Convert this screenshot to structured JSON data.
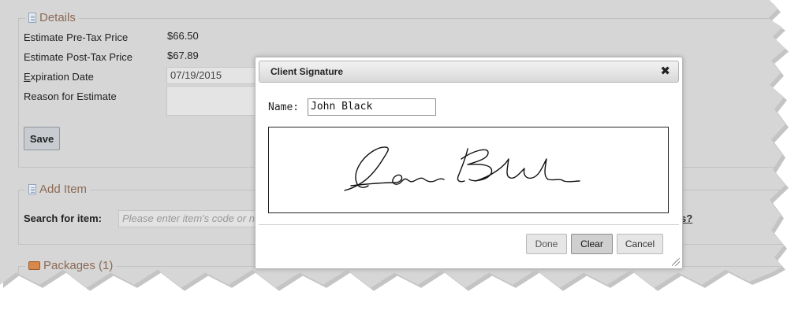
{
  "details": {
    "legend": "Details",
    "pretax_label": "Estimate Pre-Tax Price",
    "pretax_value": "$66.50",
    "posttax_label": "Estimate Post-Tax Price",
    "posttax_value": "$67.89",
    "expiration_label_first": "E",
    "expiration_label_rest": "xpiration Date",
    "expiration_value": "07/19/2015",
    "reason_label": "Reason for Estimate",
    "save_label": "Save"
  },
  "add_item": {
    "legend": "Add Item",
    "search_label": "Search for item:",
    "search_placeholder": "Please enter item's code or n",
    "help_fragment": "s?"
  },
  "packages": {
    "legend": "Packages (1)"
  },
  "dialog": {
    "title": "Client Signature",
    "close_glyph": "✖",
    "name_label": "Name:",
    "name_value": "John Black",
    "done_label": "Done",
    "clear_label": "Clear",
    "cancel_label": "Cancel"
  },
  "icons": {
    "details": "document-icon",
    "add_item": "document-icon",
    "packages": "package-icon",
    "close": "close-icon",
    "resize": "resize-grip-icon"
  }
}
